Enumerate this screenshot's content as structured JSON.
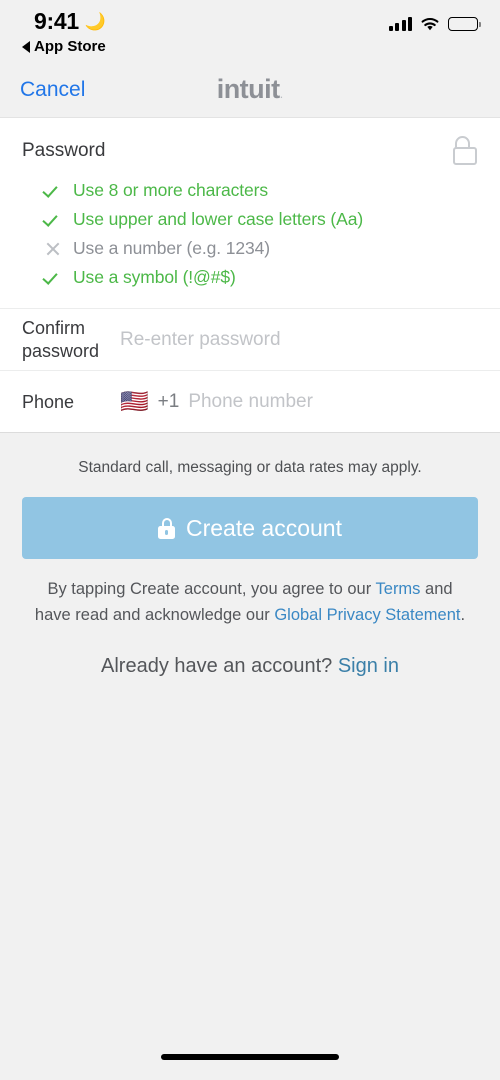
{
  "status_bar": {
    "time": "9:41",
    "dnd_icon": "crescent-moon-icon",
    "return_label": "App Store",
    "signal_icon": "cellular-signal-icon",
    "wifi_icon": "wifi-icon",
    "battery_icon": "battery-full-icon"
  },
  "nav": {
    "cancel_label": "Cancel",
    "brand": "intuit",
    "brand_dot": "."
  },
  "form": {
    "password": {
      "label": "Password",
      "lock_icon": "unlock-icon",
      "rules": [
        {
          "text": "Use 8 or more characters",
          "met": true
        },
        {
          "text": "Use upper and lower case letters (Aa)",
          "met": true
        },
        {
          "text": "Use a number (e.g. 1234)",
          "met": false
        },
        {
          "text": "Use a symbol (!@#$)",
          "met": true
        }
      ]
    },
    "confirm_password": {
      "label": "Confirm password",
      "placeholder": "Re-enter password",
      "value": ""
    },
    "phone": {
      "label": "Phone",
      "flag": "🇺🇸",
      "dial_code": "+1",
      "placeholder": "Phone number",
      "value": ""
    }
  },
  "footer": {
    "rates_note": "Standard call, messaging or data rates may apply.",
    "create_button": {
      "label": "Create account",
      "icon": "lock-icon",
      "color": "#91c5e3",
      "disabled": true
    },
    "legal": {
      "part1": "By tapping Create account, you agree to our ",
      "terms_link": "Terms",
      "part2": " and have read and acknowledge our ",
      "privacy_link": "Global Privacy Statement",
      "part3": "."
    },
    "signin": {
      "prompt": "Already have an account? ",
      "link": "Sign in"
    }
  },
  "colors": {
    "accent_blue": "#2176e8",
    "link_blue": "#3a88c4",
    "success_green": "#4cb848",
    "muted_gray": "#8d9096",
    "button_blue": "#91c5e3",
    "page_bg": "#f1f1f1"
  }
}
